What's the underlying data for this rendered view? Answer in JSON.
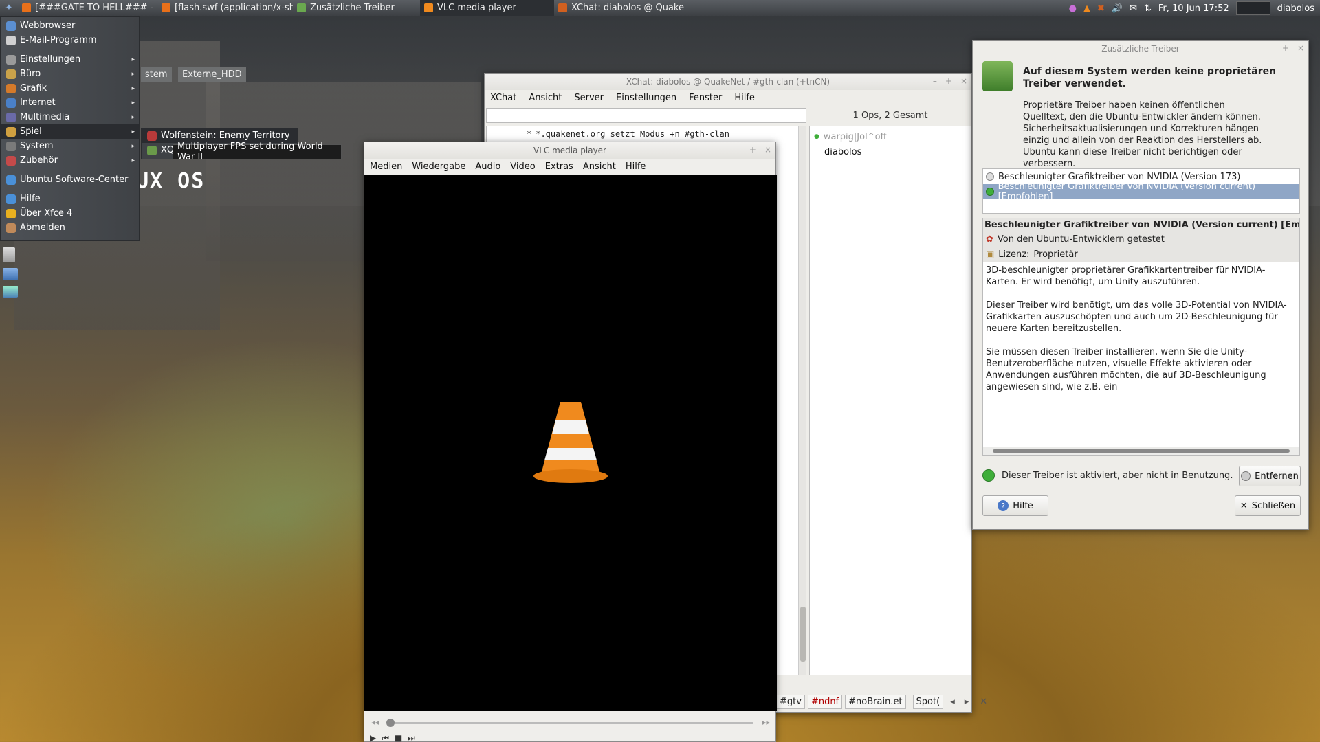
{
  "topbar": {
    "tasks": [
      {
        "label": "[###GATE TO HELL### - M...",
        "icon": "firefox-icon",
        "color": "#e8701a"
      },
      {
        "label": "[flash.swf (application/x-sh...",
        "icon": "firefox-icon",
        "color": "#e8701a"
      },
      {
        "label": "Zusätzliche Treiber",
        "icon": "driver-icon",
        "color": "#6aa84f"
      },
      {
        "label": "VLC media player",
        "icon": "vlc-icon",
        "color": "#f08a1e"
      },
      {
        "label": "XChat: diabolos @ QuakeN...",
        "icon": "xchat-icon",
        "color": "#d06020"
      }
    ],
    "clock": "Fr, 10 Jun  17:52",
    "user": "diabolos"
  },
  "appmenu": {
    "items": [
      {
        "label": "Webbrowser",
        "submenu": false
      },
      {
        "label": "E-Mail-Programm",
        "submenu": false
      },
      {
        "label": "Einstellungen",
        "submenu": true
      },
      {
        "label": "Büro",
        "submenu": true
      },
      {
        "label": "Grafik",
        "submenu": true
      },
      {
        "label": "Internet",
        "submenu": true
      },
      {
        "label": "Multimedia",
        "submenu": true
      },
      {
        "label": "Spiel",
        "submenu": true
      },
      {
        "label": "System",
        "submenu": true
      },
      {
        "label": "Zubehör",
        "submenu": true
      },
      {
        "label": "Ubuntu Software-Center",
        "submenu": false
      },
      {
        "label": "Hilfe",
        "submenu": false
      },
      {
        "label": "Über Xfce 4",
        "submenu": false
      },
      {
        "label": "Abmelden",
        "submenu": false
      }
    ],
    "submenu_items": [
      "Wolfenstein: Enemy Territory",
      "XQ"
    ],
    "tooltip": "Multiplayer FPS set during World War II"
  },
  "desktop": {
    "labels": [
      "stem",
      "Externe_HDD"
    ],
    "logo_text": "UX OS"
  },
  "xchat": {
    "title": "XChat: diabolos @ QuakeNet / #gth-clan (+tnCN)",
    "menu": [
      "XChat",
      "Ansicht",
      "Server",
      "Einstellungen",
      "Fenster",
      "Hilfe"
    ],
    "ops_summary": "1 Ops, 2 Gesamt",
    "log_lines": [
      {
        "prefix": "*",
        "text": "*.quakenet.org setzt Modus +n #gth-clan"
      }
    ],
    "users": [
      {
        "name": "warpig|Jol^off",
        "away": true
      },
      {
        "name": "diabolos",
        "away": false
      }
    ],
    "channel_tabs": [
      "#gtv",
      "#ndnf",
      "#noBrain.et",
      "Spot("
    ],
    "highlight_tab": "#ndnf"
  },
  "vlc": {
    "title": "VLC media player",
    "menu": [
      "Medien",
      "Wiedergabe",
      "Audio",
      "Video",
      "Extras",
      "Ansicht",
      "Hilfe"
    ],
    "progress": 0.0
  },
  "drivers": {
    "title": "Zusätzliche Treiber",
    "heading": "Auf diesem System werden keine proprietären Treiber verwendet.",
    "intro": "Proprietäre Treiber haben keinen öffentlichen Quelltext, den die Ubuntu-Entwickler ändern können. Sicherheitsaktualisierungen und Korrekturen hängen einzig und allein von der Reaktion des Herstellers ab. Ubuntu kann diese Treiber nicht berichtigen oder verbessern.",
    "driver_list": [
      {
        "label": "Beschleunigter Grafiktreiber von NVIDIA (Version 173)",
        "selected": false
      },
      {
        "label": "Beschleunigter Grafiktreiber von NVIDIA (Version current) [Empfohlen]",
        "selected": true
      }
    ],
    "detail_title": "Beschleunigter Grafiktreiber von NVIDIA (Version current) [Empfohlen]",
    "tested": "Von den Ubuntu-Entwicklern getestet",
    "license_label": "Lizenz:",
    "license_value": "Proprietär",
    "description": [
      "3D-beschleunigter proprietärer Grafikkartentreiber für NVIDIA-Karten. Er wird benötigt, um Unity auszuführen.",
      "Dieser Treiber wird benötigt, um das volle 3D-Potential von NVIDIA-Grafikkarten auszuschöpfen und auch um 2D-Beschleunigung für neuere Karten bereitzustellen.",
      "Sie müssen diesen Treiber installieren, wenn Sie die Unity-Benutzeroberfläche nutzen, visuelle Effekte aktivieren oder Anwendungen ausführen möchten, die auf 3D-Beschleunigung angewiesen sind, wie z.B. ein"
    ],
    "status": "Dieser Treiber ist aktiviert, aber nicht in Benutzung.",
    "remove_label": "Entfernen",
    "help_label": "Hilfe",
    "close_label": "Schließen"
  },
  "colors": {
    "panel": "#3d4044",
    "selection": "#8fa6c6",
    "vlc_orange": "#f08a1e",
    "status_green": "#3fae3a"
  }
}
